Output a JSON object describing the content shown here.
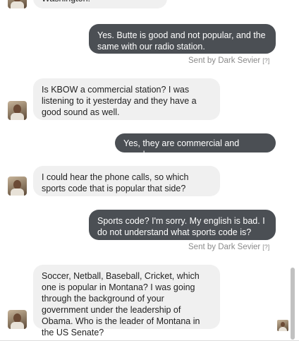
{
  "messages": [
    {
      "sender": "them",
      "text": "Washington."
    },
    {
      "sender": "me",
      "text": "Yes.  Butte is good and not popular, and the same with our radio station."
    },
    {
      "sender": "them",
      "text": "Is KBOW a commercial station? I was listening to it yesterday and they have a good sound as well."
    },
    {
      "sender": "me",
      "text": "Yes, they are commercial and popular."
    },
    {
      "sender": "them",
      "text": "I could hear the phone calls, so which sports code that is popular that side?"
    },
    {
      "sender": "me",
      "text": "Sports code?  I'm sorry.  My english is bad.  I do not understand what sports code is?"
    },
    {
      "sender": "them",
      "text": "Soccer, Netball, Baseball, Cricket, which one is popular in Montana? I was going through the background of your government under the leadership of Obama. Who is the leader of Montana in the US Senate?"
    }
  ],
  "sent_by": {
    "label": "Sent by Dark Sevier",
    "help": "[?]"
  },
  "icons": {
    "avatar": "user-avatar",
    "help": "help-link"
  }
}
